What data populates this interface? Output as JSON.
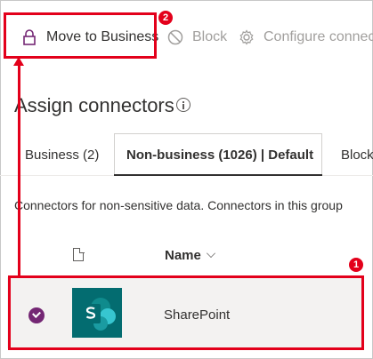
{
  "toolbar": {
    "move_to_business": "Move to Business",
    "block": "Block",
    "configure": "Configure connect"
  },
  "main": {
    "heading": "Assign connectors",
    "tabs": [
      {
        "label": "Business (2)"
      },
      {
        "label": "Non-business (1026) | Default"
      },
      {
        "label": "Block"
      }
    ],
    "description": "Connectors for non-sensitive data. Connectors in this group",
    "table": {
      "columns": {
        "name": "Name"
      },
      "rows": [
        {
          "name": "SharePoint",
          "selected": true
        }
      ]
    }
  },
  "annotations": {
    "badge_1": "1",
    "badge_2": "2"
  },
  "colors": {
    "accent": "#742774",
    "annotation": "#e3001b",
    "sharepoint": "#036c70"
  }
}
